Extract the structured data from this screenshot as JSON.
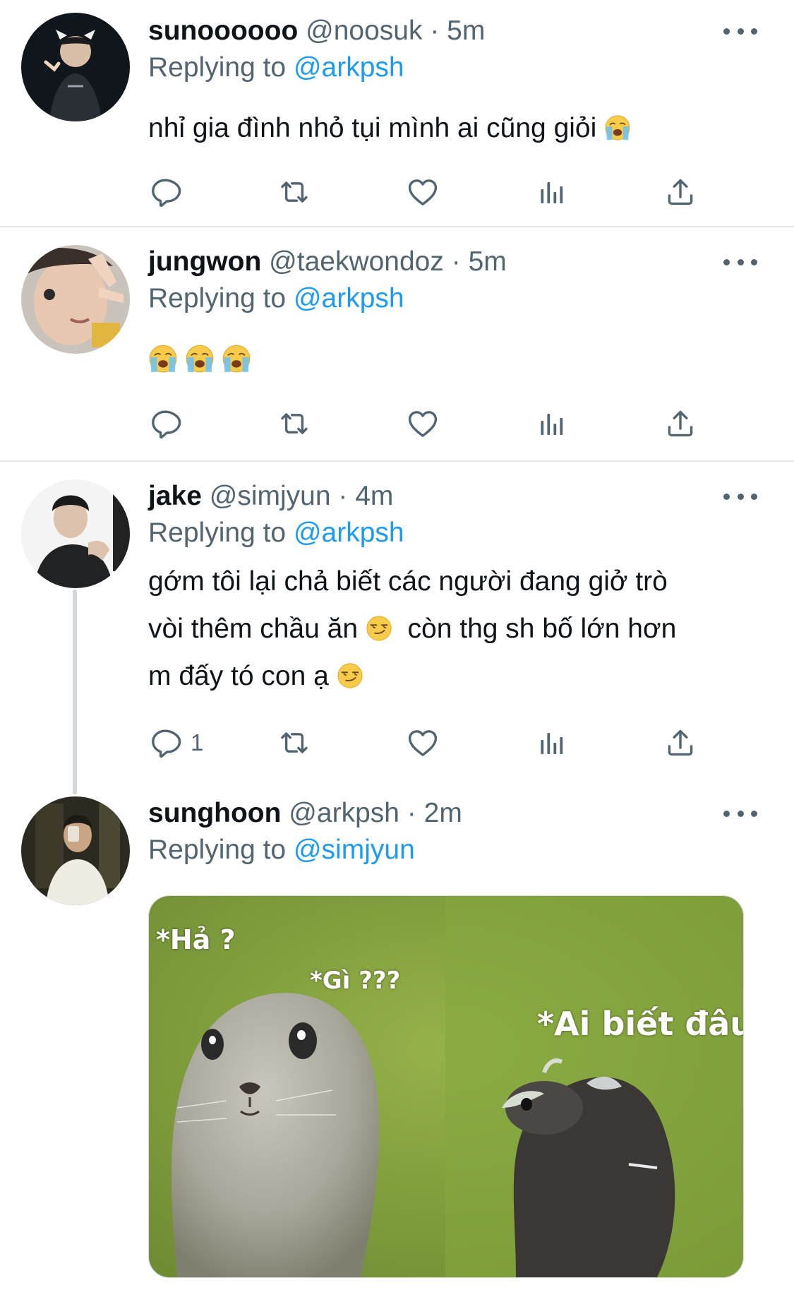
{
  "tweets": [
    {
      "name": "sunoooooo",
      "handle": "@noosuk",
      "separator": "·",
      "time": "5m",
      "replying_prefix": "Replying to",
      "replying_to": "@arkpsh",
      "text": "nhỉ gia đình nhỏ tụi mình ai cũng giỏi",
      "emojis": [
        "loudly-crying-face"
      ],
      "reply_count": ""
    },
    {
      "name": "jungwon",
      "handle": "@taekwondoz",
      "separator": "·",
      "time": "5m",
      "replying_prefix": "Replying to",
      "replying_to": "@arkpsh",
      "text": "",
      "emojis": [
        "loudly-crying-face",
        "loudly-crying-face",
        "loudly-crying-face"
      ],
      "reply_count": ""
    },
    {
      "name": "jake",
      "handle": "@simjyun",
      "separator": "·",
      "time": "4m",
      "replying_prefix": "Replying to",
      "replying_to": "@arkpsh",
      "text_line1": "gớm tôi lại chả biết các người đang giở trò",
      "text_line2a": "vòi thêm chầu ăn",
      "text_line2b": "còn thg sh bố lớn hơn",
      "text_line3": "m đấy tó con ạ",
      "emojis": [
        "smirking-face",
        "smirking-face"
      ],
      "reply_count": "1"
    },
    {
      "name": "sunghoon",
      "handle": "@arkpsh",
      "separator": "·",
      "time": "2m",
      "replying_prefix": "Replying to",
      "replying_to": "@simjyun",
      "media_captions": [
        "*Hả ?",
        "*Gì ???",
        "*Ai biết đâu"
      ]
    }
  ],
  "icons": {
    "reply": "reply-icon",
    "retweet": "retweet-icon",
    "like": "heart-icon",
    "analytics": "analytics-icon",
    "share": "share-icon",
    "more": "more-icon"
  },
  "colors": {
    "name": "#0f1419",
    "secondary": "#536471",
    "mention": "#1d9bf0",
    "divider": "#e6e6e6",
    "thread_line": "#d3d8dc",
    "media_background": "#7e9a3c"
  }
}
